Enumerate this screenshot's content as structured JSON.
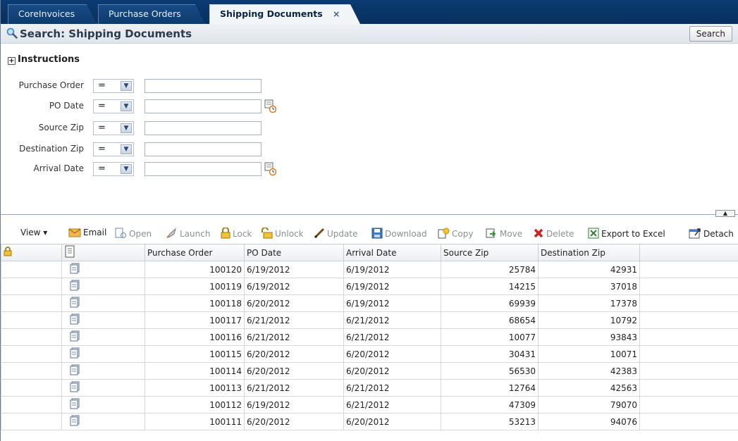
{
  "tabs": [
    {
      "label": "CoreInvoices"
    },
    {
      "label": "Purchase Orders"
    },
    {
      "label": "Shipping Documents",
      "close": "×"
    }
  ],
  "search": {
    "title": "Search: Shipping Documents",
    "button_label": "Search",
    "instructions_label": "Instructions",
    "operator": "=",
    "fields": [
      {
        "label": "Purchase Order",
        "value": ""
      },
      {
        "label": "PO Date",
        "value": ""
      },
      {
        "label": "Source Zip",
        "value": ""
      },
      {
        "label": "Destination Zip",
        "value": ""
      },
      {
        "label": "Arrival Date",
        "value": ""
      }
    ]
  },
  "toolbar": {
    "view": "View",
    "email": "Email",
    "open": "Open",
    "launch": "Launch",
    "lock": "Lock",
    "unlock": "Unlock",
    "update": "Update",
    "download": "Download",
    "copy": "Copy",
    "move": "Move",
    "delete": "Delete",
    "export": "Export to Excel",
    "detach": "Detach"
  },
  "table": {
    "columns": [
      "Purchase Order",
      "PO Date",
      "Arrival Date",
      "Source Zip",
      "Destination Zip"
    ],
    "rows": [
      [
        "100120",
        "6/19/2012",
        "6/19/2012",
        "25784",
        "42931"
      ],
      [
        "100119",
        "6/19/2012",
        "6/19/2012",
        "14215",
        "37018"
      ],
      [
        "100118",
        "6/20/2012",
        "6/19/2012",
        "69939",
        "17378"
      ],
      [
        "100117",
        "6/21/2012",
        "6/21/2012",
        "68654",
        "10792"
      ],
      [
        "100116",
        "6/21/2012",
        "6/21/2012",
        "10077",
        "93843"
      ],
      [
        "100115",
        "6/20/2012",
        "6/20/2012",
        "30431",
        "10071"
      ],
      [
        "100114",
        "6/20/2012",
        "6/20/2012",
        "56530",
        "42383"
      ],
      [
        "100113",
        "6/21/2012",
        "6/21/2012",
        "12764",
        "42563"
      ],
      [
        "100112",
        "6/19/2012",
        "6/21/2012",
        "47309",
        "79070"
      ],
      [
        "100111",
        "6/20/2012",
        "6/20/2012",
        "53213",
        "94076"
      ]
    ]
  },
  "colors": {
    "tabbar": "#0b3b73",
    "accent": "#2b4a78"
  }
}
